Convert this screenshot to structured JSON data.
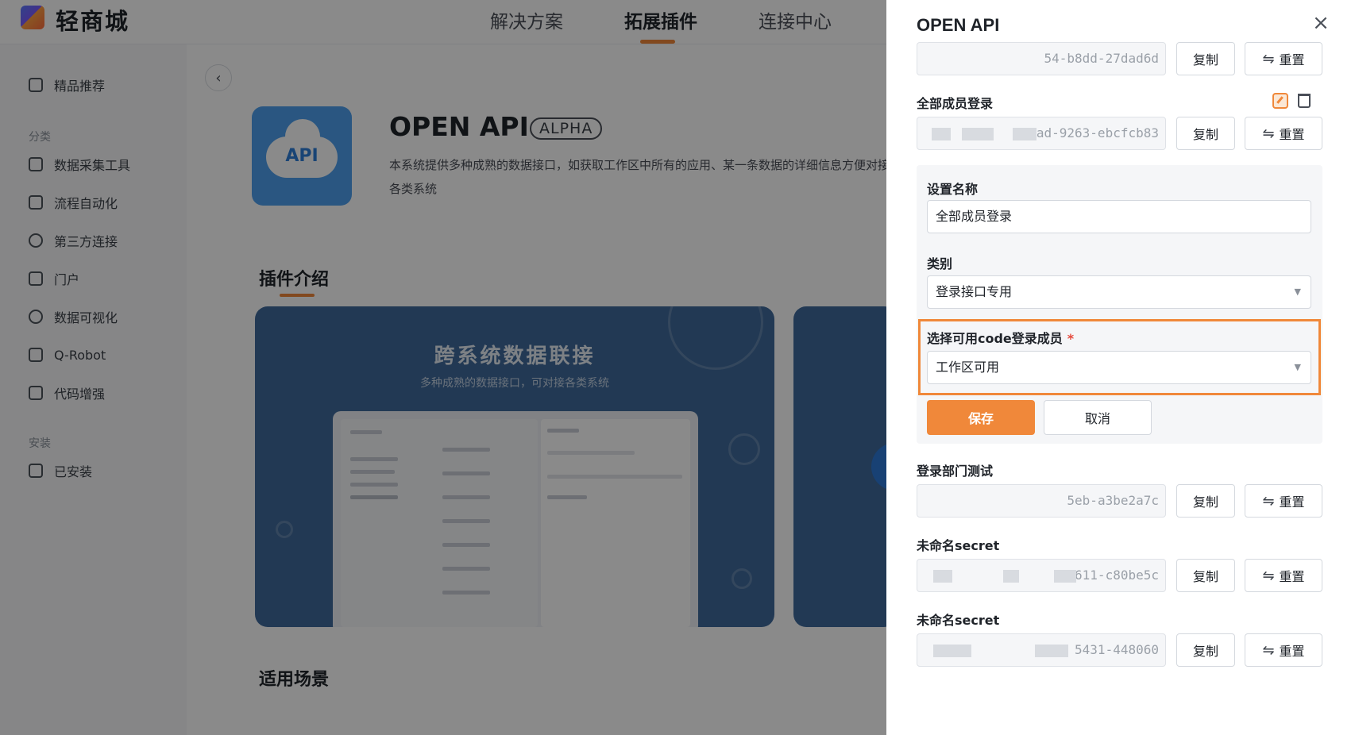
{
  "app": {
    "logo_text": "轻商城"
  },
  "nav": [
    {
      "label": "解决方案"
    },
    {
      "label": "拓展插件"
    },
    {
      "label": "连接中心"
    }
  ],
  "sidebar": {
    "featured": "精品推荐",
    "group_category": "分类",
    "items": [
      {
        "label": "数据采集工具"
      },
      {
        "label": "流程自动化"
      },
      {
        "label": "第三方连接"
      },
      {
        "label": "门户"
      },
      {
        "label": "数据可视化"
      },
      {
        "label": "Q-Robot"
      },
      {
        "label": "代码增强"
      }
    ],
    "group_install": "安装",
    "installed": "已安装"
  },
  "product": {
    "logo_label": "API",
    "title": "OPEN API",
    "badge": "ALPHA",
    "description": "本系统提供多种成熟的数据接口，如获取工作区中所有的应用、某一条数据的详细信息方便对接各类系统"
  },
  "sections": {
    "intro": "插件介绍",
    "scenes": "适用场景"
  },
  "banner": {
    "title": "跨系统数据联接",
    "subtitle": "多种成熟的数据接口，可对接各类系统"
  },
  "drawer": {
    "title": "OPEN API",
    "copy_label": "复制",
    "reset_label": "重置",
    "keys": [
      {
        "label": "",
        "value": "54-b8dd-27dad6d"
      },
      {
        "label": "全部成员登录",
        "value": "5ad-9263-ebcfcb83"
      },
      {
        "label": "登录部门测试",
        "value": "5eb-a3be2a7c"
      },
      {
        "label": "未命名secret",
        "value": "611-c80be5c"
      },
      {
        "label": "未命名secret",
        "value": "5431-448060"
      }
    ],
    "form": {
      "name_label": "设置名称",
      "name_value": "全部成员登录",
      "type_label": "类别",
      "type_value": "登录接口专用",
      "member_label": "选择可用code登录成员",
      "required_mark": "*",
      "member_value": "工作区可用",
      "save_label": "保存",
      "cancel_label": "取消"
    }
  },
  "colors": {
    "accent": "#f0883a",
    "overlay": "rgba(0,0,0,0.46)",
    "banner": "#3f6a9c"
  }
}
